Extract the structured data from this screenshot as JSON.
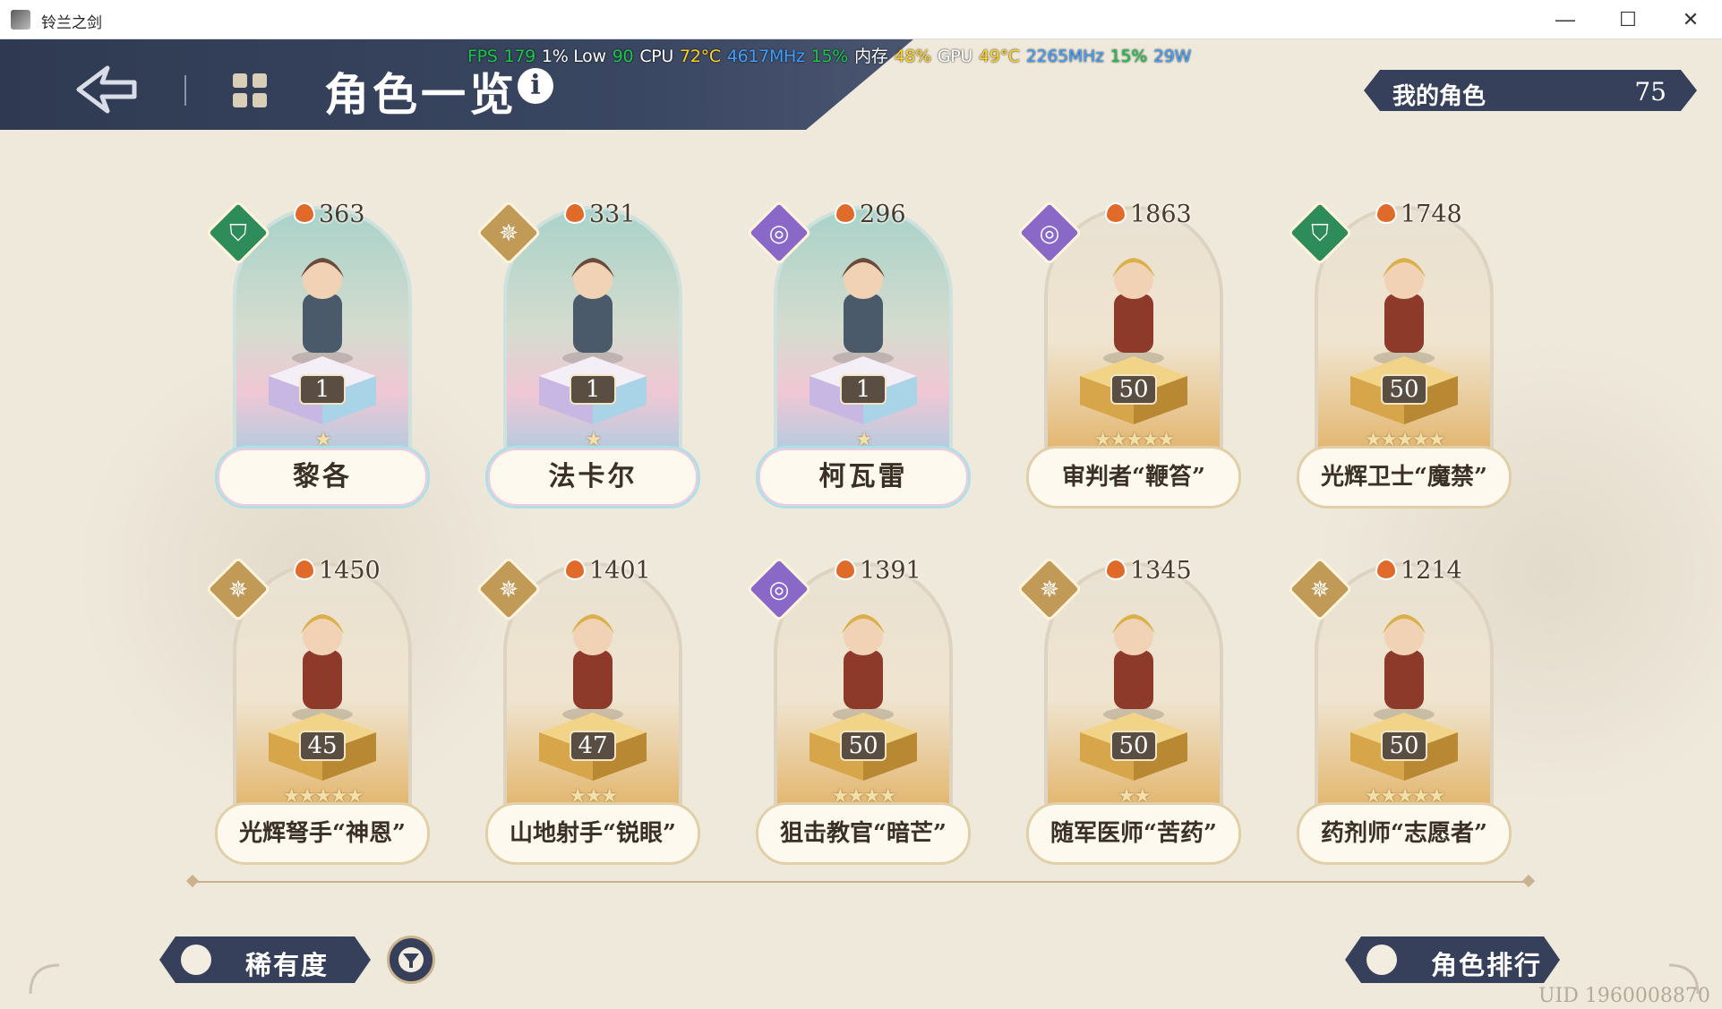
{
  "window": {
    "title": "铃兰之剑",
    "minimize_icon": "—",
    "maximize_icon": "☐",
    "close_icon": "✕"
  },
  "header": {
    "title": "角色一览",
    "info_icon": "i"
  },
  "fps_overlay": [
    {
      "text": "FPS",
      "color": "#19c64a"
    },
    {
      "text": "179",
      "color": "#19c64a"
    },
    {
      "text": "1% Low",
      "color": "#ffffff"
    },
    {
      "text": "90",
      "color": "#19c64a"
    },
    {
      "text": "CPU",
      "color": "#ffffff"
    },
    {
      "text": "72°C",
      "color": "#ffd21f"
    },
    {
      "text": "4617MHz",
      "color": "#3fa0ff"
    },
    {
      "text": "15%",
      "color": "#19c64a"
    },
    {
      "text": "内存",
      "color": "#ffffff"
    },
    {
      "text": "48%",
      "color": "#ffd21f"
    },
    {
      "text": "GPU",
      "color": "#ffffff"
    },
    {
      "text": "49°C",
      "color": "#ffd21f"
    },
    {
      "text": "2265MHz",
      "color": "#3fa0ff"
    },
    {
      "text": "15%",
      "color": "#19c64a"
    },
    {
      "text": "29W",
      "color": "#3fa0ff"
    }
  ],
  "my_characters": {
    "label": "我的角色",
    "count": "75"
  },
  "characters": [
    {
      "name": "黎各",
      "power": "363",
      "level": "1",
      "stars": "★",
      "class_color": "green",
      "class_icon": "shield-icon"
    },
    {
      "name": "法卡尔",
      "power": "331",
      "level": "1",
      "stars": "★",
      "class_color": "gold",
      "class_icon": "compass-icon"
    },
    {
      "name": "柯瓦雷",
      "power": "296",
      "level": "1",
      "stars": "★",
      "class_color": "purple",
      "class_icon": "spiral-icon"
    },
    {
      "name": "审判者“鞭笞”",
      "power": "1863",
      "level": "50",
      "stars": "★★★★★",
      "class_color": "purple",
      "class_icon": "spiral-icon"
    },
    {
      "name": "光辉卫士“魔禁”",
      "power": "1748",
      "level": "50",
      "stars": "★★★★★",
      "class_color": "green",
      "class_icon": "shield-icon"
    },
    {
      "name": "光辉弩手“神恩”",
      "power": "1450",
      "level": "45",
      "stars": "★★★★★",
      "class_color": "gold",
      "class_icon": "compass-icon"
    },
    {
      "name": "山地射手“锐眼”",
      "power": "1401",
      "level": "47",
      "stars": "★★★",
      "class_color": "gold",
      "class_icon": "compass-icon"
    },
    {
      "name": "狙击教官“暗芒”",
      "power": "1391",
      "level": "50",
      "stars": "★★★★",
      "class_color": "purple",
      "class_icon": "spiral-icon"
    },
    {
      "name": "随军医师“苦药”",
      "power": "1345",
      "level": "50",
      "stars": "★★",
      "class_color": "gold",
      "class_icon": "compass-icon"
    },
    {
      "name": "药剂师“志愿者”",
      "power": "1214",
      "level": "50",
      "stars": "★★★★★",
      "class_color": "gold",
      "class_icon": "compass-icon"
    }
  ],
  "bottom": {
    "rarity_label": "稀有度",
    "ranking_label": "角色排行",
    "uid": "UID 1960008870"
  }
}
